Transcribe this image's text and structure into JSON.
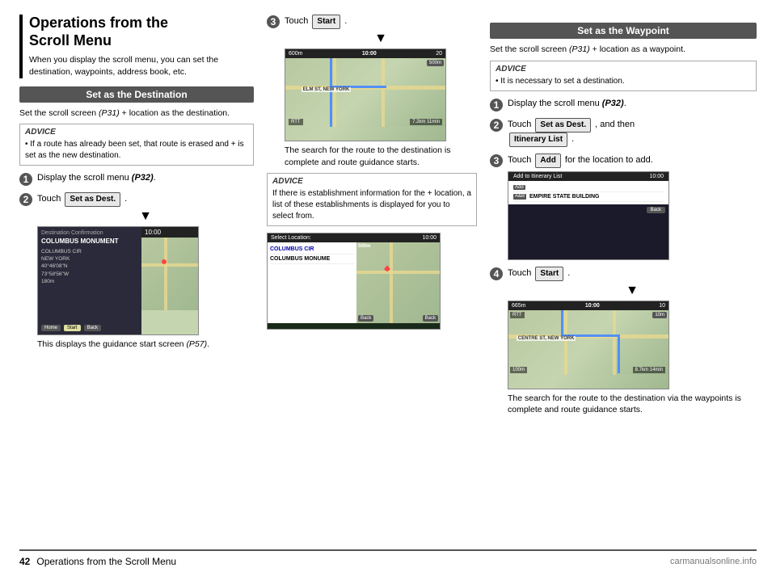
{
  "page": {
    "left_section_title": "Operations from the\nScroll Menu",
    "left_section_subtitle": "When you display the scroll menu, you can set the destination, waypoints, address book, etc.",
    "dest_section_title": "Set as the Destination",
    "dest_body": "Set the scroll screen (P31) + location as the destination.",
    "advice_label": "ADVICE",
    "advice_left_1": "If a route has already been set, that route is erased and + is set as the new destination.",
    "step1_label": "1",
    "step1_text": "Display the scroll menu (P32).",
    "step2_label": "2",
    "step2_text": "Touch",
    "step2_btn": "Set as Dest.",
    "step2_suffix": ".",
    "screen_caption": "This displays the guidance start screen (P57).",
    "step3_mid_label": "3",
    "step3_mid_text": "Touch",
    "step3_mid_btn": "Start",
    "step3_mid_suffix": ".",
    "mid_caption": "The search for the route to the destination is complete and route guidance starts.",
    "advice_mid": "If there is establishment information for the + location, a list of these establishments is displayed for you to select from.",
    "waypoint_section_title": "Set as the Waypoint",
    "waypoint_body": "Set the scroll screen (P31) + location as a waypoint.",
    "advice_waypoint": "It is necessary to set a destination.",
    "wp_step1_text": "Display the scroll menu (P32).",
    "wp_step2_text": "Touch",
    "wp_step2_btn": "Set as Dest.",
    "wp_step2_suffix": ", and then",
    "wp_step2_btn2": "Itinerary List",
    "wp_step2_suffix2": ".",
    "wp_step3_text": "Touch",
    "wp_step3_btn": "Add",
    "wp_step3_suffix": "for the location to add.",
    "wp_step4_text": "Touch",
    "wp_step4_btn": "Start",
    "wp_step4_suffix": ".",
    "wp_caption": "The search for the route to the destination via the waypoints is complete and route guidance starts.",
    "footer_page": "42",
    "footer_title": "Operations from the Scroll Menu",
    "dest_confirm_title": "Destination Confirmation",
    "dest_confirm_name": "COLUMBUS MONUMENT",
    "dest_confirm_detail1": "COLUMBUS CIR",
    "dest_confirm_detail2": "NEW YORK",
    "dest_confirm_lat": "40°46'08\"N",
    "dest_confirm_lon": "73°58'56\"W",
    "dest_confirm_dist": "180m",
    "btn_home": "Home",
    "btn_back": "Back",
    "btn_start": "Start",
    "screen_time": "10:00",
    "select_title": "Select Location:",
    "select_item1": "COLUMBUS CIR",
    "select_item2": "COLUMBUS MONUME",
    "add_itinerary_title": "Add to Itinerary List",
    "wp_add_item1": "Add",
    "wp_add_item2": "A&B",
    "wp_add_name": "EMPIRE STATE BUILDING",
    "dist_val1": "7.2km",
    "dist_val2": "8.7km",
    "time_val1": "11min",
    "time_val2": "14min"
  }
}
